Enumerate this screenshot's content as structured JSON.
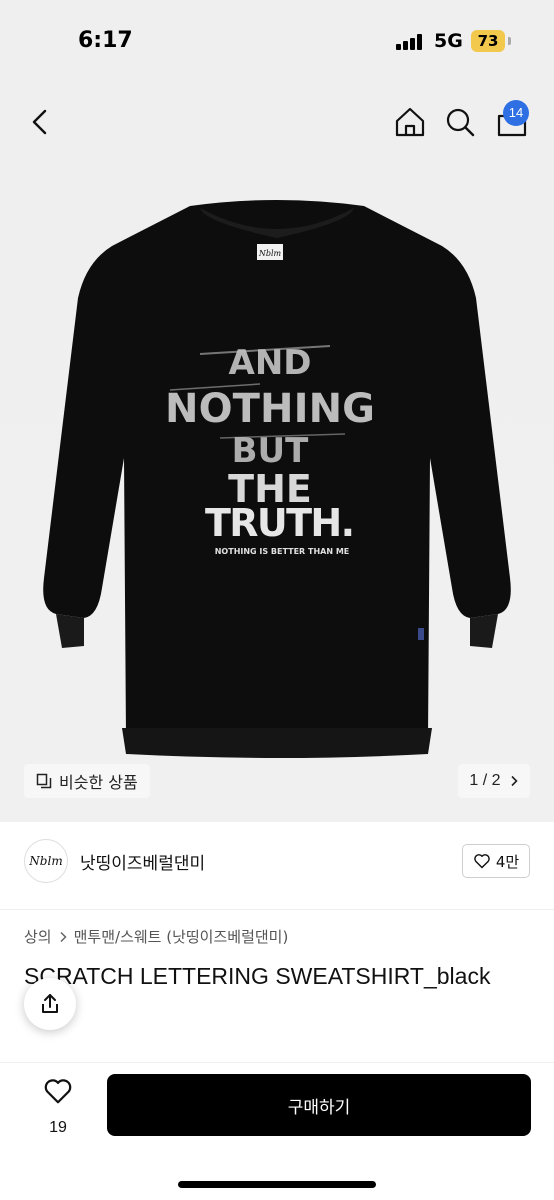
{
  "status_bar": {
    "time": "6:17",
    "network": "5G",
    "battery": "73"
  },
  "nav": {
    "back_icon": "chevron-left-icon",
    "home_icon": "home-icon",
    "search_icon": "search-icon",
    "cart_icon": "shopping-bag-icon",
    "cart_count": "14"
  },
  "product_image": {
    "graphic_lines": [
      "AND",
      "NOTHING",
      "BUT",
      "THE",
      "TRUTH."
    ],
    "graphic_tagline": "NOTHING IS BETTER THAN ME",
    "neck_tag": "Nblm",
    "similar_label": "비슷한 상품",
    "counter": "1 / 2"
  },
  "brand": {
    "logo_text": "Nblm",
    "name": "낫띵이즈베럴댄미",
    "likes": "4만"
  },
  "breadcrumb": {
    "category": "상의",
    "subcategory": "맨투맨/스웨트 (낫띵이즈베럴댄미)"
  },
  "product": {
    "title": "SCRATCH LETTERING SWEATSHIRT_black"
  },
  "bottom_bar": {
    "wish_count": "19",
    "buy_label": "구매하기"
  },
  "colors": {
    "accent": "#2f6fe4",
    "battery": "#f2c94c",
    "buy_button": "#000000",
    "garment": "#0d0d0d"
  }
}
